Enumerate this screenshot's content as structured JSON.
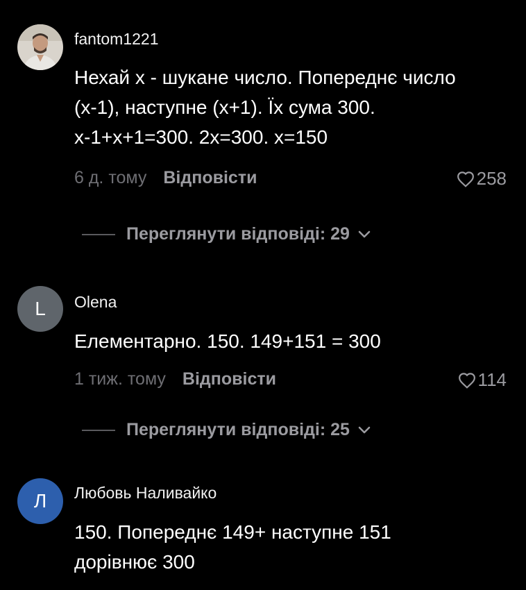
{
  "comments": [
    {
      "author": "fantom1221",
      "avatar_type": "photo",
      "text": "Нехай x - шукане число. Попереднє число\n(x-1), наступне (x+1). Їх сума 300.\nx-1+x+1=300. 2x=300. x=150",
      "time": "6 д. тому",
      "reply_label": "Відповісти",
      "likes": "258",
      "view_replies": "Переглянути відповіді: 29"
    },
    {
      "author": "Olena",
      "avatar_type": "letter",
      "avatar_letter": "L",
      "avatar_color": "#5f656b",
      "text": "Елементарно. 150. 149+151 = 300",
      "time": "1 тиж. тому",
      "reply_label": "Відповісти",
      "likes": "114",
      "view_replies": "Переглянути відповіді: 25"
    },
    {
      "author": "Любовь Наливайко",
      "avatar_type": "letter",
      "avatar_letter": "Л",
      "avatar_color": "#2d5fad",
      "text": "150. Попереднє 149+ наступне 151\nдорівнює 300"
    }
  ],
  "icons": {
    "like": "heart-outline-icon",
    "expand": "chevron-down-icon"
  }
}
